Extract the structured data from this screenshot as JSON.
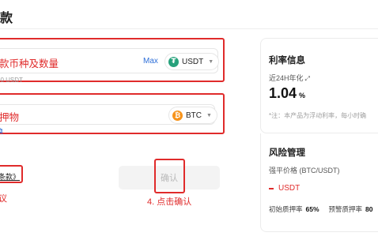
{
  "page": {
    "title": "款"
  },
  "amount": {
    "label": "款币种及数量",
    "max_label": "Max",
    "coin": "USDT",
    "available": "00 USDT"
  },
  "collateral": {
    "label": "押物",
    "coin": "BTC",
    "link": "换"
  },
  "terms": {
    "link": "条款》",
    "note": "议"
  },
  "confirm": {
    "label": "确认",
    "step_note": "4. 点击确认"
  },
  "rate_panel": {
    "title": "利率信息",
    "period_label": "近24H年化",
    "rate_value": "1.04",
    "rate_unit": "%",
    "note": "*注：本产品为浮动利率，每小时确"
  },
  "risk_panel": {
    "title": "风险管理",
    "liq_label": "强平价格 (BTC/USDT)",
    "liq_unit": "USDT",
    "initial_label": "初始质押率",
    "initial_value": "65%",
    "warning_label": "预警质押率",
    "warning_value": "80"
  },
  "colors": {
    "annotation": "#e02b2b",
    "usdt": "#26a17b",
    "btc": "#f7931a",
    "link": "#2e6fd8"
  },
  "icons": [
    "usdt-icon",
    "btc-icon",
    "chevron-down-icon",
    "external-link-icon",
    "dash-icon"
  ]
}
